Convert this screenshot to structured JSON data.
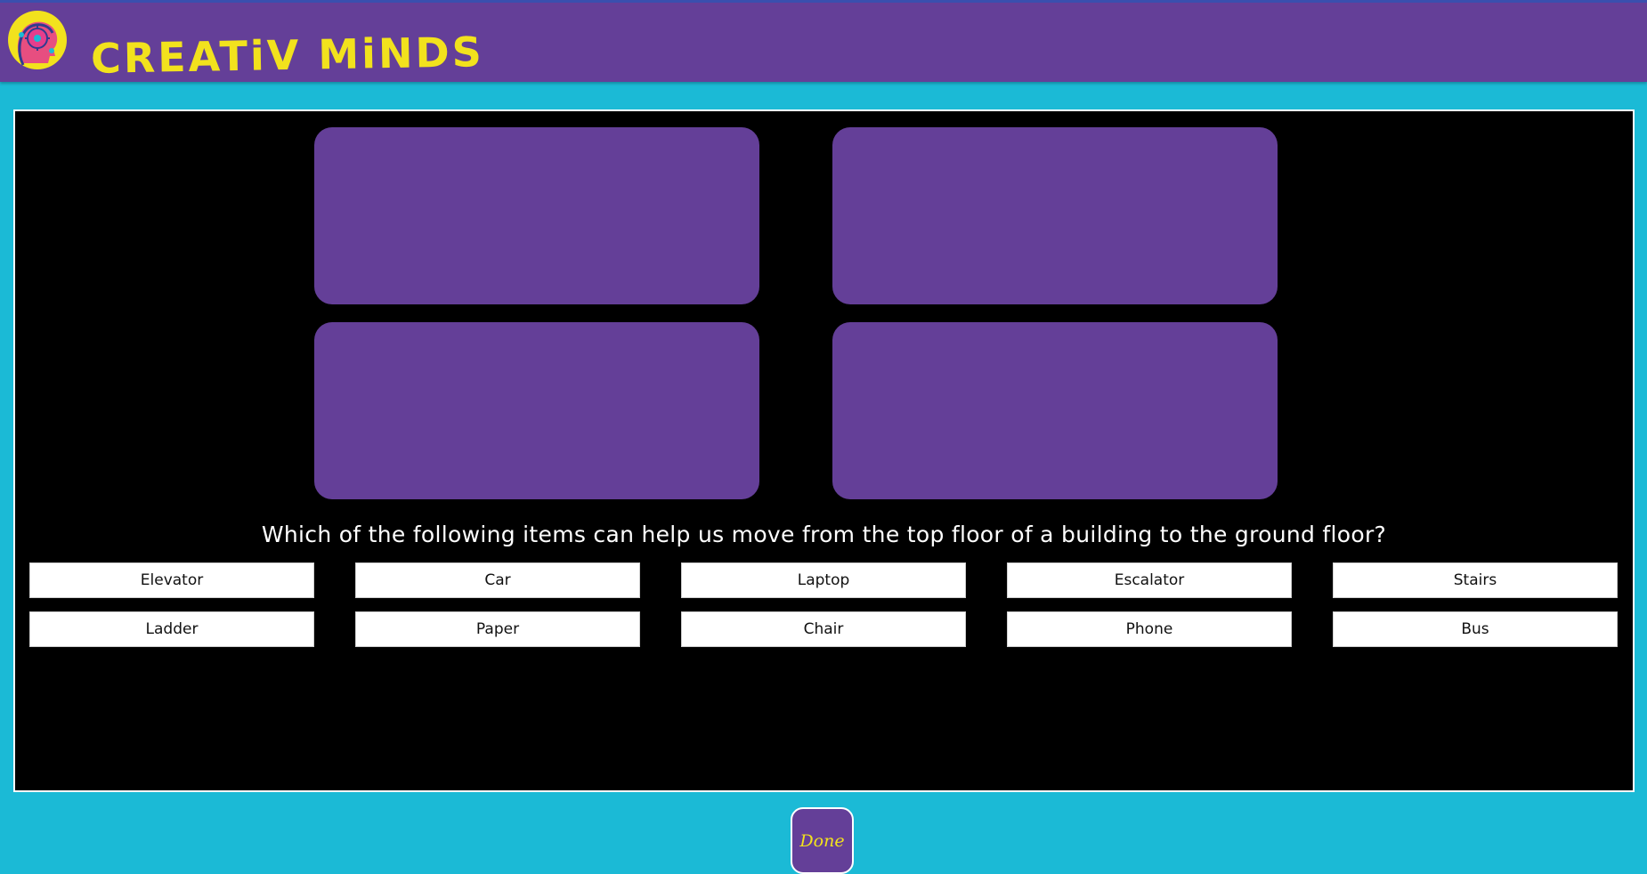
{
  "header": {
    "brand": "CREATiV MiNDS",
    "logo_icon": "brain-gear-head-icon",
    "background": "#643f98",
    "brand_color": "#f2e21d"
  },
  "game": {
    "question": "Which of the following items can help us move from the top floor of a building to the ground floor?",
    "cards": [
      {
        "name": "answer-card-1"
      },
      {
        "name": "answer-card-2"
      },
      {
        "name": "answer-card-3"
      },
      {
        "name": "answer-card-4"
      }
    ],
    "options": [
      "Elevator",
      "Car",
      "Laptop",
      "Escalator",
      "Stairs",
      "Ladder",
      "Paper",
      "Chair",
      "Phone",
      "Bus"
    ]
  },
  "footer": {
    "done_label": "Done"
  },
  "colors": {
    "page_background": "#1bbad6",
    "accent_purple": "#643f98",
    "accent_yellow": "#f2e21d",
    "stage_background": "#000000"
  }
}
